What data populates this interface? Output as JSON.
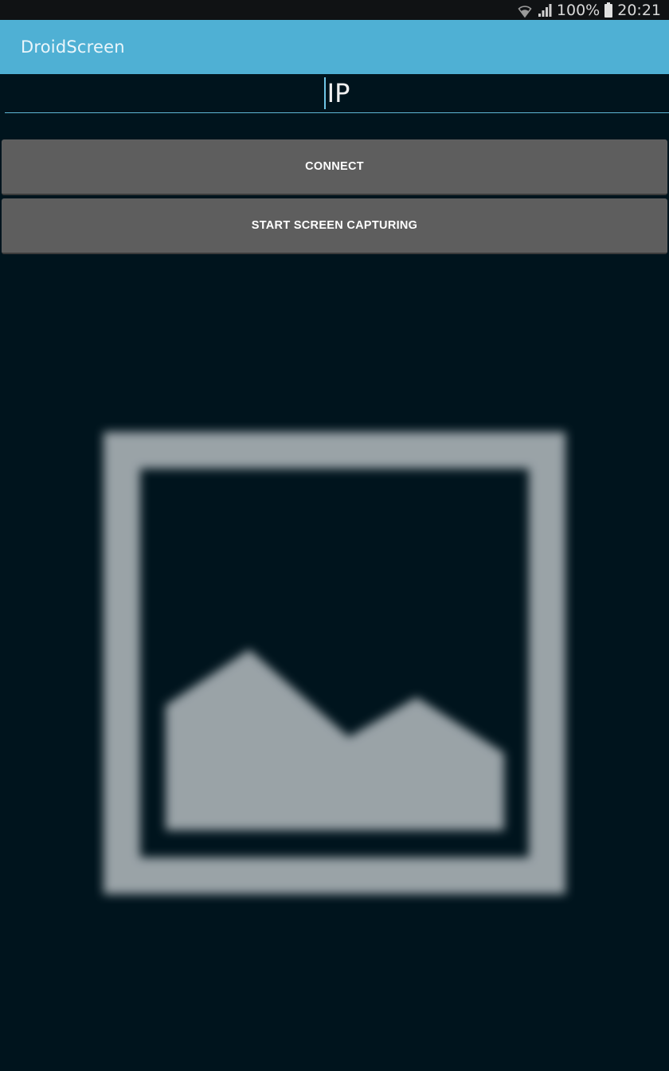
{
  "status_bar": {
    "battery_percent": "100%",
    "time": "20:21",
    "icons": [
      "wifi-icon",
      "signal-icon",
      "battery-icon"
    ]
  },
  "action_bar": {
    "title": "DroidScreen",
    "color": "#4fb0d4"
  },
  "ip_input": {
    "value": "IP"
  },
  "buttons": {
    "connect_label": "CONNECT",
    "capture_label": "START SCREEN CAPTURING"
  },
  "image_view": {
    "icon": "image-placeholder-icon"
  },
  "colors": {
    "background": "#00141d",
    "button": "#5e5e5e",
    "accent": "#4fb0d4",
    "placeholder": "#9aa3a7"
  }
}
